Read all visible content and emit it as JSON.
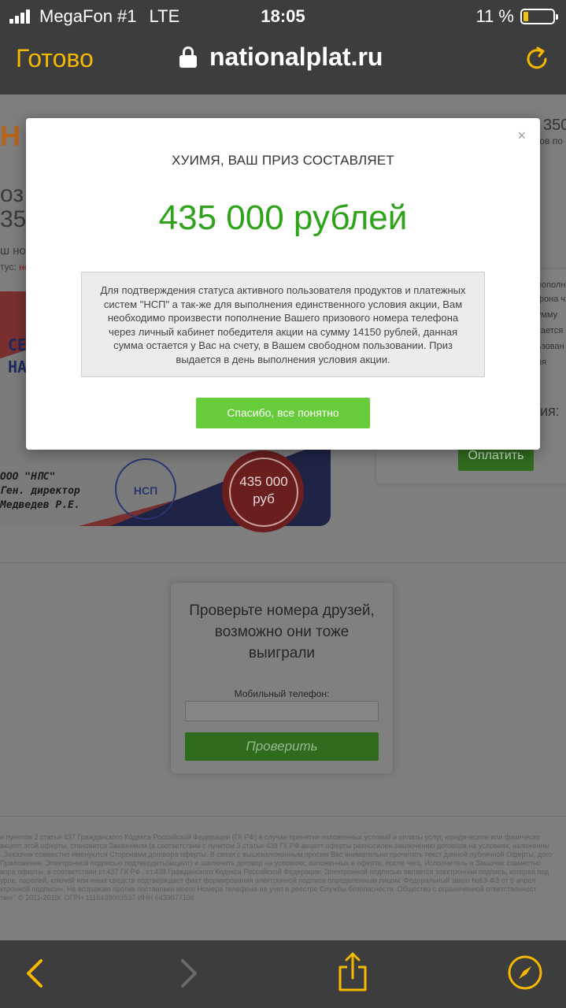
{
  "status_bar": {
    "carrier": "MegaFon #1",
    "network": "LTE",
    "time": "18:05",
    "battery": "11 %",
    "battery_level": 0.11
  },
  "browser": {
    "done_label": "Готово",
    "url": "nationalplat.ru"
  },
  "background_page": {
    "logo_fragment": "Н",
    "header_phone_fragment": "350",
    "header_sub_fragment": "ков по",
    "heading_fragment_1": "оз",
    "heading_fragment_2": "35",
    "text_fragment_1": "ш но",
    "status_prefix": "тус:",
    "status_value": "не",
    "certificate": {
      "blue_text_1": "СЕ",
      "blue_text_2": "НА",
      "company": "ООО \"НПС\"",
      "director": "Ген. директор",
      "name": "Медведев Р.Е.",
      "stamp_text": "НСП",
      "seal_amount": "435 000",
      "seal_currency": "руб"
    },
    "payment_card": {
      "lines": [
        "пополне",
        "фона ч",
        "умму",
        "тается",
        "ьзован",
        "ия"
      ],
      "text_1": "ния:",
      "text_2": "й",
      "pay_button": "Оплатить"
    },
    "check_friends": {
      "title": "Проверьте номера друзей, возможно они тоже выиграли",
      "phone_label": "Мобильный телефон:",
      "phone_value": "",
      "check_button": "Проверить"
    },
    "fineprint": [
      "и пунктом 2 статьи 437 Гражданского Кодекса Российской Федерации (ГК РФ) в случае принятия изложенных условий и оплаты услуг, юридическое или физическо",
      "акцепт этой оферты, становится Заказчиком (в соответствии с пунктом 3 статьи 438 ГК РФ акцепт оферты равносилен заключению договора на условиях, изложенны",
      ". Заказчик совместно именуются Сторонами договора оферты. В связи с вышеизложенным просим Вас внимательно прочитать текст данной публичной Оферты, дого",
      "Приложения. Электронной подписью подтвердить(акцепт) и заключить договор на условиях, изложенных в оферте, после чего, Исполнитель и Заказчик совместно",
      "вора оферты, в соответствии ст.437 ГК РФ , ст.438 Гражданского Кодекса Российской Федерации. Электронной подписью является электронная подпись, которая под",
      "уров, паролей, ключей или иных средств подтверждает факт формирования электронной подписи определенным лицом. Федеральный закон №63-ФЗ от 6 апрел",
      "ктронной подписи». Не возражаю против постановки моего Номера телефона на учет в реестре Службы безопасности. Общество с ограниченной ответственност",
      "тинг\" © 2011-2019г. ОГРН 1116439003537 ИНН 6439077106"
    ]
  },
  "modal": {
    "close_symbol": "×",
    "title": "ХУИМЯ, ВАШ ПРИЗ СОСТАВЛЯЕТ",
    "prize": "435 000 рублей",
    "info_text": "Для подтверждения статуса активного пользователя продуктов и платежных систем \"НСП\" а так-же для выполнения единственного условия акции, Вам необходимо произвести пополнение Вашего призового номера телефона через личный кабинет победителя акции на сумму 14150 рублей, данная сумма остается у Вас на счету, в Вашем свободном пользовании. Приз выдается в день выполнения условия акции.",
    "ok_button": "Спасибо, все понятно"
  },
  "toolbar": {
    "icons": [
      "back-icon",
      "forward-icon",
      "share-icon",
      "compass-icon"
    ]
  },
  "colors": {
    "accent": "#f5b800",
    "prize_green": "#2ea31a",
    "button_green": "#66cc3a",
    "bar_background": "#3d3d3d"
  }
}
